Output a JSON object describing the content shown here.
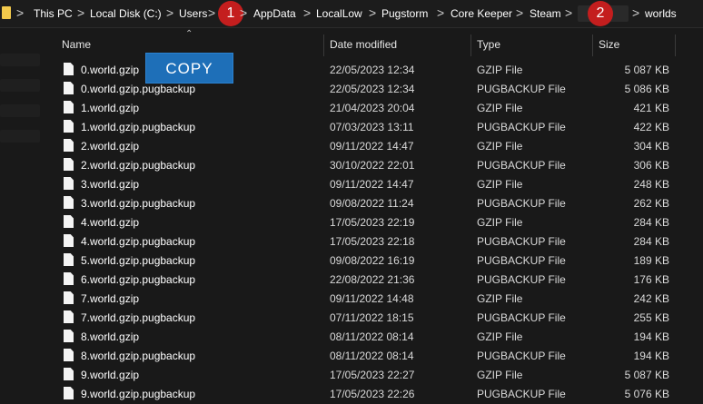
{
  "addressbar": {
    "crumbs": [
      "This PC",
      "Local Disk (C:)",
      "Users",
      "AppData",
      "LocalLow",
      "Pugstorm",
      "Core Keeper",
      "Steam",
      "worlds"
    ],
    "separator": ">",
    "badges": [
      "1",
      "2"
    ]
  },
  "columns": {
    "name": "Name",
    "date": "Date modified",
    "type": "Type",
    "size": "Size"
  },
  "overlay": {
    "copy_label": "COPY"
  },
  "files": [
    {
      "name": "0.world.gzip",
      "date": "22/05/2023 12:34",
      "type": "GZIP File",
      "size": "5 087 KB"
    },
    {
      "name": "0.world.gzip.pugbackup",
      "date": "22/05/2023 12:34",
      "type": "PUGBACKUP File",
      "size": "5 086 KB"
    },
    {
      "name": "1.world.gzip",
      "date": "21/04/2023 20:04",
      "type": "GZIP File",
      "size": "421 KB"
    },
    {
      "name": "1.world.gzip.pugbackup",
      "date": "07/03/2023 13:11",
      "type": "PUGBACKUP File",
      "size": "422 KB"
    },
    {
      "name": "2.world.gzip",
      "date": "09/11/2022 14:47",
      "type": "GZIP File",
      "size": "304 KB"
    },
    {
      "name": "2.world.gzip.pugbackup",
      "date": "30/10/2022 22:01",
      "type": "PUGBACKUP File",
      "size": "306 KB"
    },
    {
      "name": "3.world.gzip",
      "date": "09/11/2022 14:47",
      "type": "GZIP File",
      "size": "248 KB"
    },
    {
      "name": "3.world.gzip.pugbackup",
      "date": "09/08/2022 11:24",
      "type": "PUGBACKUP File",
      "size": "262 KB"
    },
    {
      "name": "4.world.gzip",
      "date": "17/05/2023 22:19",
      "type": "GZIP File",
      "size": "284 KB"
    },
    {
      "name": "4.world.gzip.pugbackup",
      "date": "17/05/2023 22:18",
      "type": "PUGBACKUP File",
      "size": "284 KB"
    },
    {
      "name": "5.world.gzip.pugbackup",
      "date": "09/08/2022 16:19",
      "type": "PUGBACKUP File",
      "size": "189 KB"
    },
    {
      "name": "6.world.gzip.pugbackup",
      "date": "22/08/2022 21:36",
      "type": "PUGBACKUP File",
      "size": "176 KB"
    },
    {
      "name": "7.world.gzip",
      "date": "09/11/2022 14:48",
      "type": "GZIP File",
      "size": "242 KB"
    },
    {
      "name": "7.world.gzip.pugbackup",
      "date": "07/11/2022 18:15",
      "type": "PUGBACKUP File",
      "size": "255 KB"
    },
    {
      "name": "8.world.gzip",
      "date": "08/11/2022 08:14",
      "type": "GZIP File",
      "size": "194 KB"
    },
    {
      "name": "8.world.gzip.pugbackup",
      "date": "08/11/2022 08:14",
      "type": "PUGBACKUP File",
      "size": "194 KB"
    },
    {
      "name": "9.world.gzip",
      "date": "17/05/2023 22:27",
      "type": "GZIP File",
      "size": "5 087 KB"
    },
    {
      "name": "9.world.gzip.pugbackup",
      "date": "17/05/2023 22:26",
      "type": "PUGBACKUP File",
      "size": "5 076 KB"
    }
  ],
  "colors": {
    "background": "#191919",
    "badge": "#c41e1e",
    "copy_overlay": "#1e6fb8",
    "folder_icon": "#f2c94c"
  }
}
